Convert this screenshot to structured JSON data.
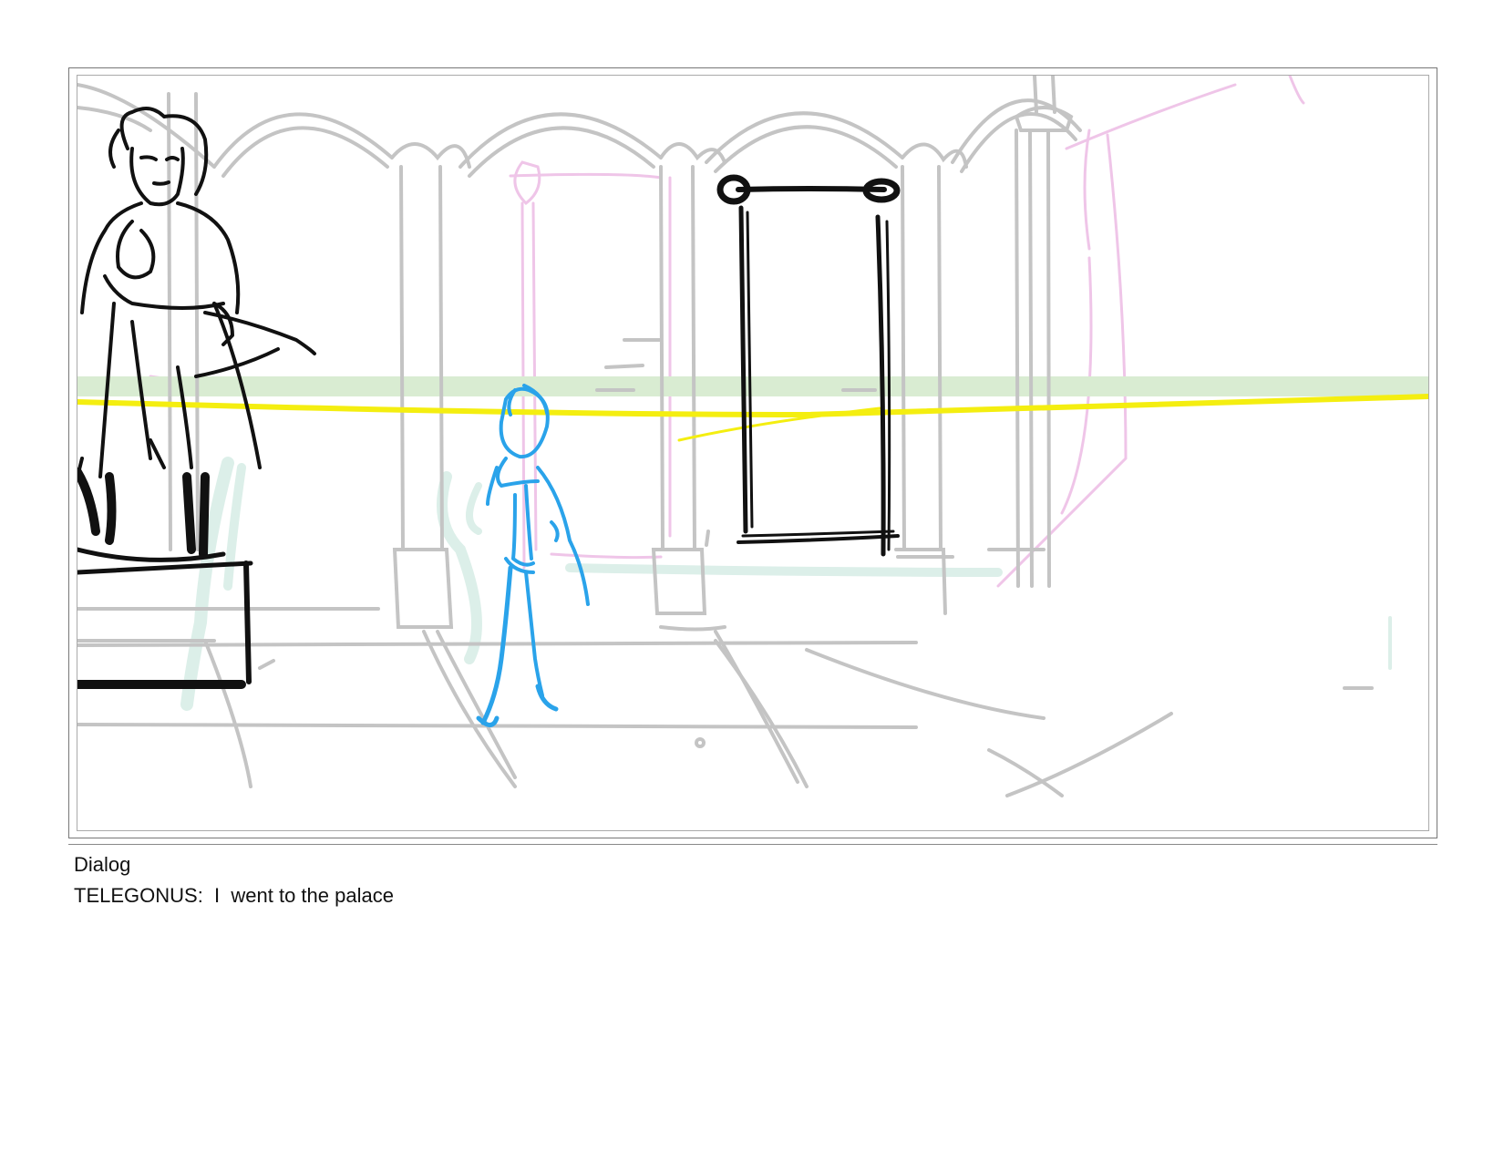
{
  "caption": {
    "heading": "Dialog",
    "line": "TELEGONUS:  I  went to the palace"
  },
  "sketch_layers": {
    "architecture": "#c4c4c4",
    "statue": "#111111",
    "figure": "#2aa3ea",
    "horizon_line": "#f4ee10",
    "pink_guides": "#efc5e8",
    "green_guides": "#d9ecd2"
  }
}
